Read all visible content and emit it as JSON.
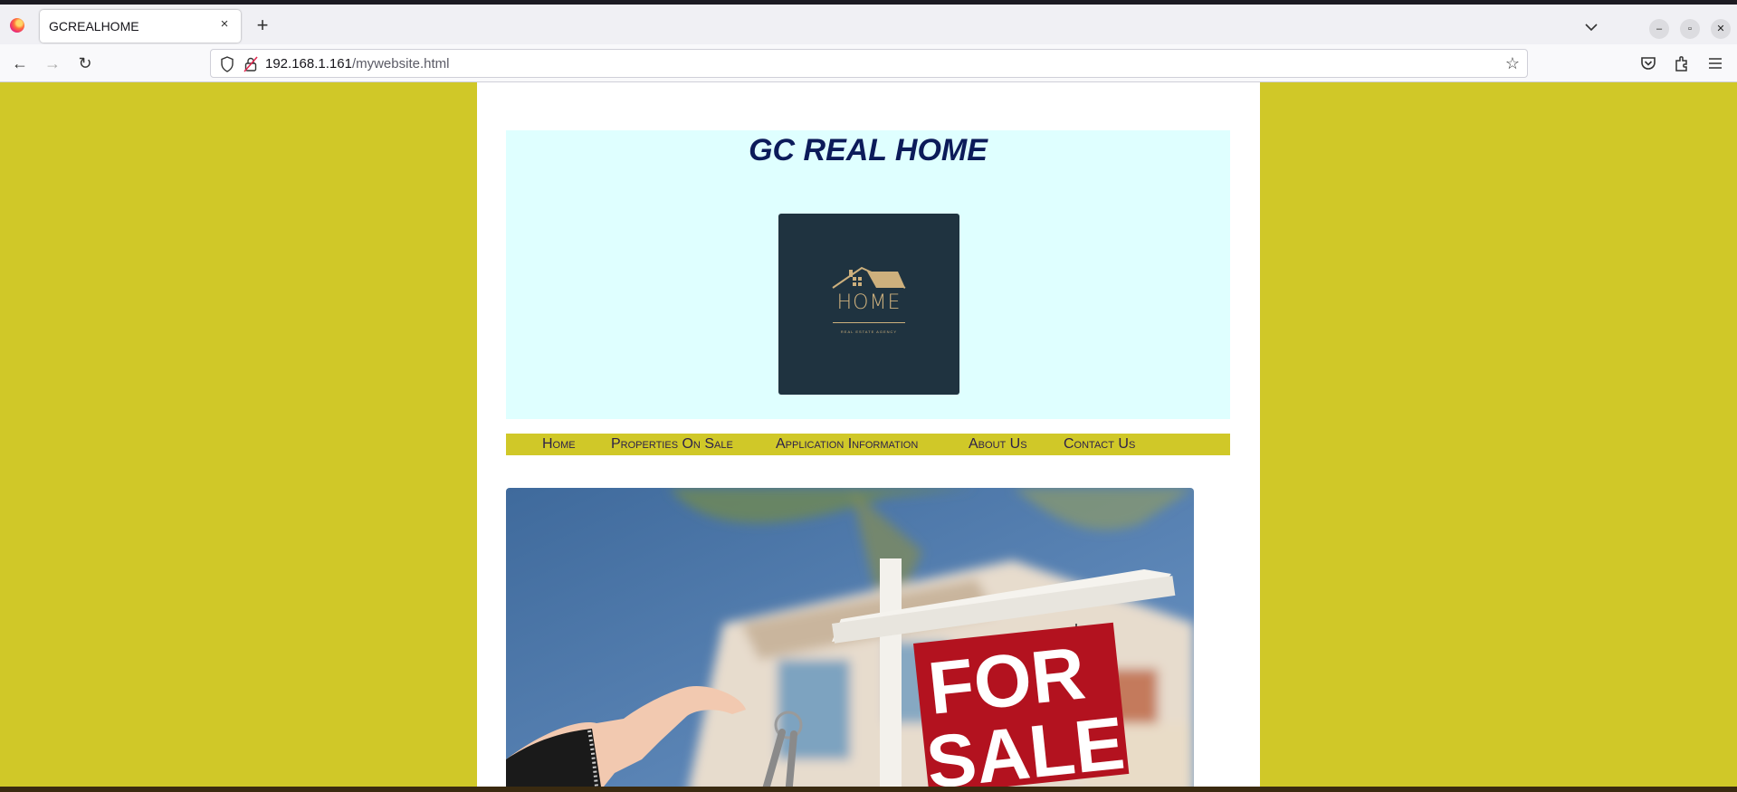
{
  "browser": {
    "tab_title": "GCREALHOME",
    "url_host": "192.168.1.161",
    "url_path": "/mywebsite.html",
    "tab_close_glyph": "×",
    "new_tab_glyph": "+"
  },
  "site": {
    "title": "GC REAL HOME",
    "logo": {
      "word": "HOME",
      "tagline": "REAL ESTATE AGENCY",
      "bg_color": "#1f3340",
      "accent_color": "#cdb07d"
    },
    "menu": [
      {
        "label": "Home"
      },
      {
        "label": "Properties On Sale"
      },
      {
        "label": "Application Information"
      },
      {
        "label": "About Us"
      },
      {
        "label": "Contact Us"
      }
    ],
    "hero": {
      "sign_line1": "FOR",
      "sign_line2": "SALE"
    }
  },
  "colors": {
    "page_bg": "#d0c828",
    "header_bg": "#dfffff",
    "title_color": "#0c1b5a",
    "menu_bg": "#d0c828",
    "menu_text": "#2b1f4a",
    "sign_red": "#b3121f"
  }
}
